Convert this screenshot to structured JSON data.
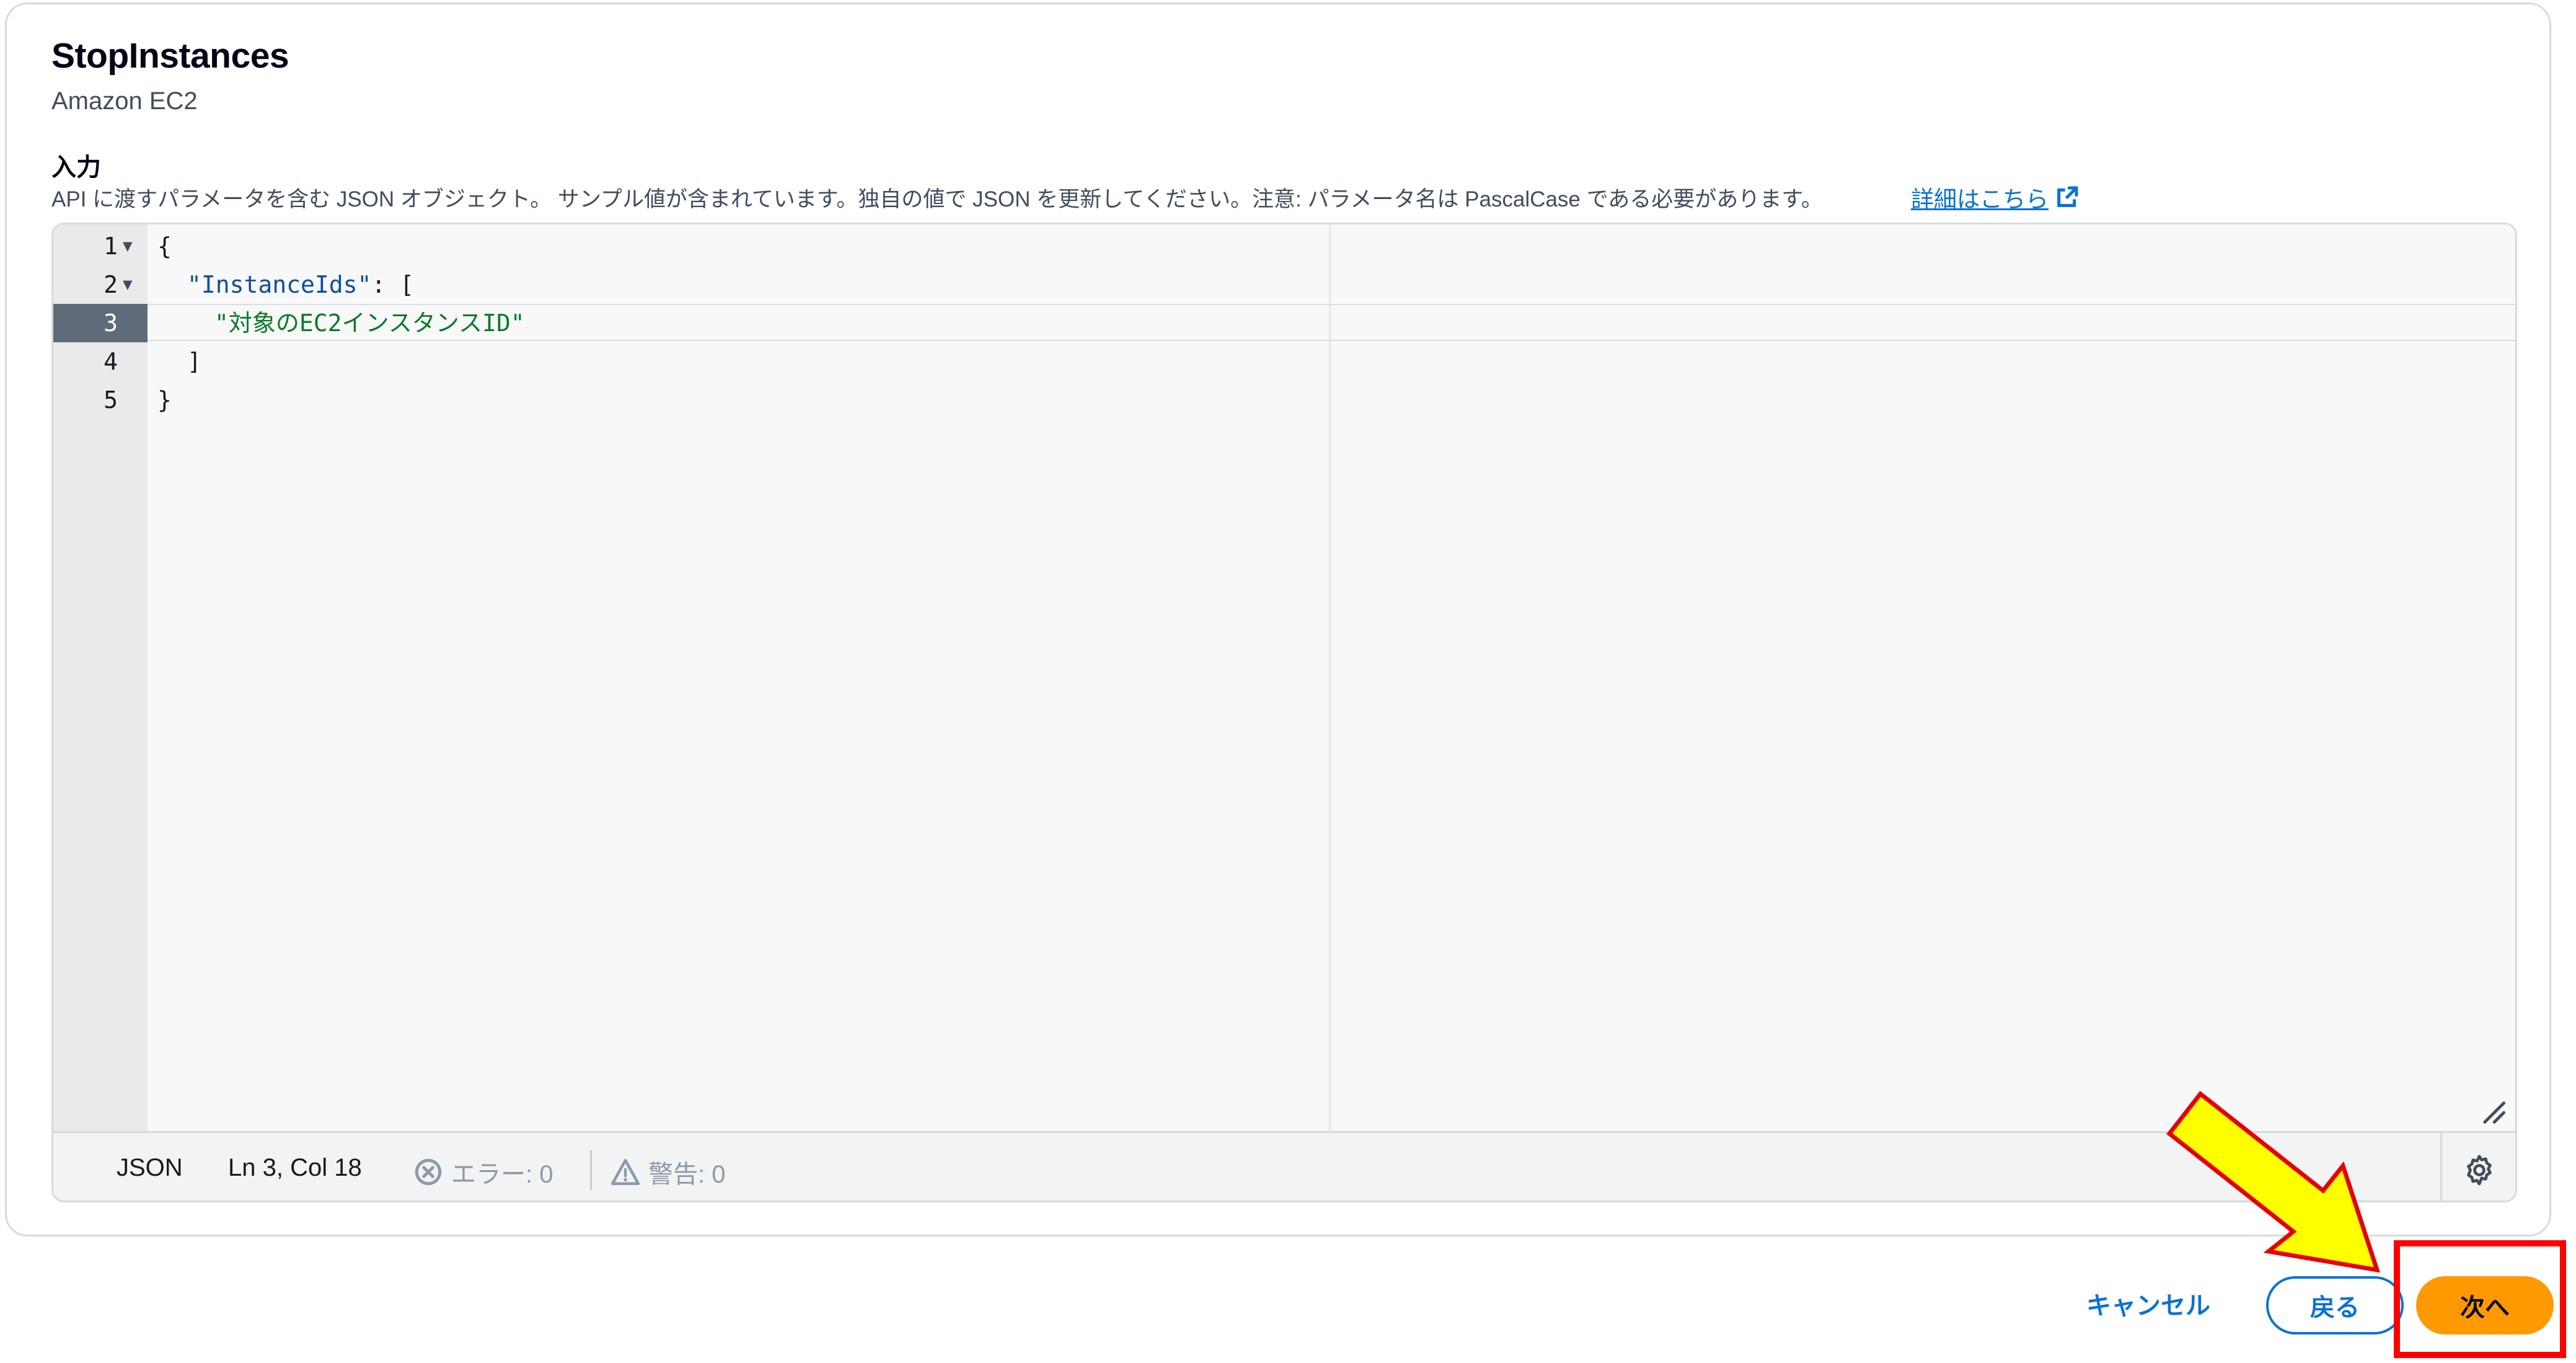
{
  "header": {
    "title": "StopInstances",
    "service": "Amazon EC2"
  },
  "input": {
    "label": "入力",
    "description": "API に渡すパラメータを含む JSON オブジェクト。 サンプル値が含まれています。独自の値で JSON を更新してください。注意: パラメータ名は PascalCase である必要があります。",
    "learn_more": "詳細はこちら"
  },
  "editor": {
    "lines": [
      {
        "num": "1",
        "fold": "▼",
        "text": "{"
      },
      {
        "num": "2",
        "fold": "▼",
        "key": "\"InstanceIds\"",
        "rest": ": ["
      },
      {
        "num": "3",
        "fold": "",
        "str": "\"対象のEC2インスタンスID\""
      },
      {
        "num": "4",
        "fold": "",
        "text": "]"
      },
      {
        "num": "5",
        "fold": "",
        "text": "}"
      }
    ],
    "status": {
      "language": "JSON",
      "position": "Ln 3, Col 18",
      "errors": "エラー: 0",
      "warnings": "警告: 0"
    }
  },
  "footer": {
    "cancel": "キャンセル",
    "back": "戻る",
    "next": "次へ"
  },
  "colors": {
    "primary": "#0972d3",
    "next_button": "#ff9900",
    "highlight": "#ff0000",
    "arrow": "#ffff00"
  },
  "icons": {
    "external_link": "external-link-icon",
    "error": "error-icon",
    "warning": "warning-icon",
    "settings": "gear-icon",
    "resize": "resize-handle-icon"
  }
}
